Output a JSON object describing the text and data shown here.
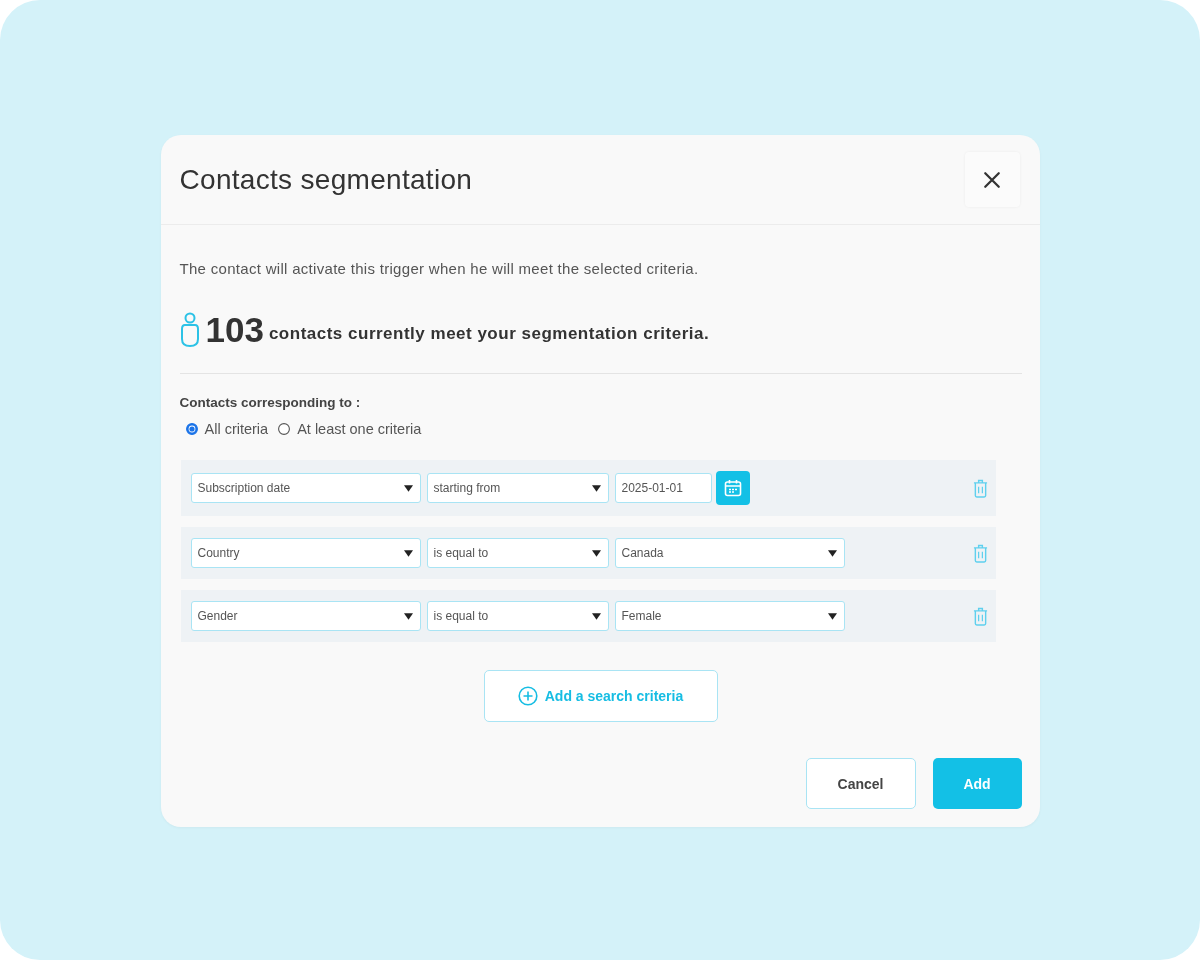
{
  "dialog": {
    "title": "Contacts segmentation",
    "description": "The contact will activate this trigger when he will meet the selected criteria.",
    "summary": {
      "count": "103",
      "text": "contacts currently meet your segmentation criteria."
    },
    "match": {
      "label": "Contacts corresponding to :",
      "options": [
        {
          "label": "All criteria",
          "selected": true
        },
        {
          "label": "At least one criteria",
          "selected": false
        }
      ]
    },
    "criteria": [
      {
        "field": "Subscription date",
        "operator": "starting from",
        "value": {
          "kind": "date",
          "text": "2025-01-01"
        }
      },
      {
        "field": "Country",
        "operator": "is equal to",
        "value": {
          "kind": "select",
          "text": "Canada"
        }
      },
      {
        "field": "Gender",
        "operator": "is equal to",
        "value": {
          "kind": "select",
          "text": "Female"
        }
      }
    ],
    "add_button": "Add a search criteria",
    "buttons": [
      {
        "label": "Cancel",
        "kind": "secondary"
      },
      {
        "label": "Add",
        "kind": "primary"
      }
    ]
  }
}
